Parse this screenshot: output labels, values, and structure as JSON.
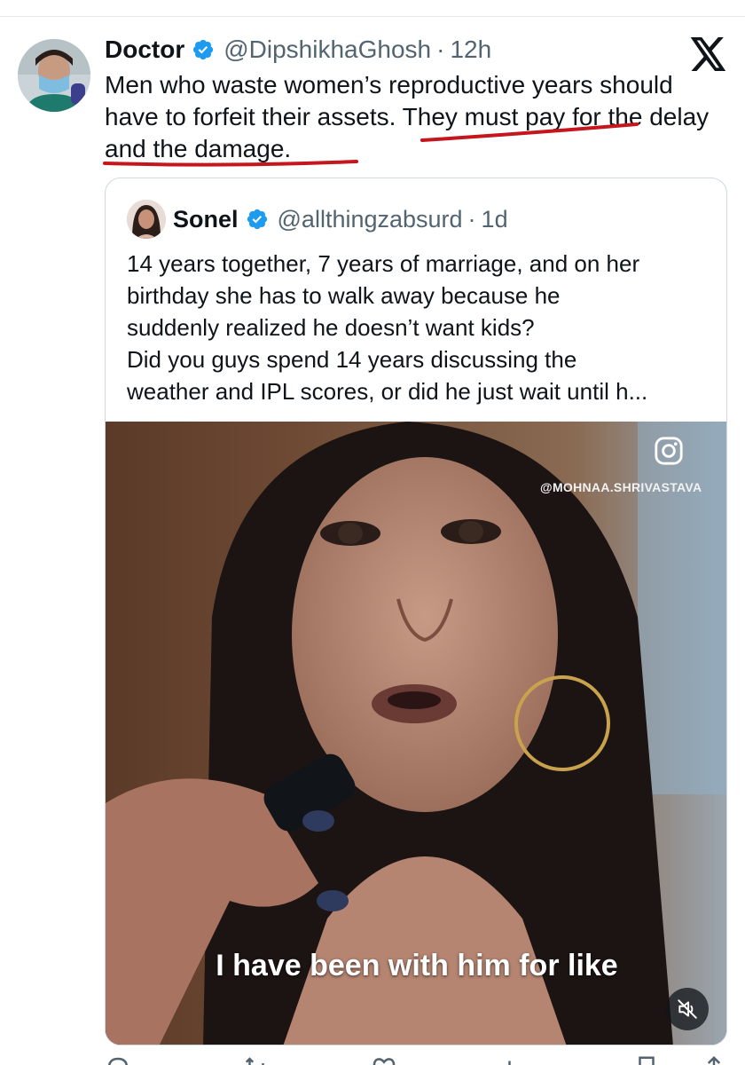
{
  "tweet": {
    "author_name": "Doctor",
    "handle": "@DipshikhaGhosh",
    "separator": "·",
    "time": "12h",
    "text_part1": "Men who waste women’s reproductive years should have to forfeit their assets. They must pay for the delay and the damage.",
    "underline_color": "#c4161c"
  },
  "quote": {
    "author_name": "Sonel",
    "handle": "@allthingzabsurd",
    "separator": "·",
    "time": "1d",
    "lines": [
      "14 years together, 7 years of marriage, and on her",
      "birthday she has to walk away because he",
      "suddenly realized he doesn’t want kids?",
      "Did you guys spend 14 years discussing the",
      "weather and IPL scores, or did he just wait until h..."
    ]
  },
  "video": {
    "watermark_handle": "@MOHNAA.SHRIVASTAVA",
    "caption": "I have been with him for like",
    "watermark_icon": "instagram-icon",
    "mute_icon": "speaker-muted-icon"
  },
  "colors": {
    "verified_blue": "#1d9bf0",
    "secondary_text": "#536471",
    "border": "#cfd9de"
  }
}
